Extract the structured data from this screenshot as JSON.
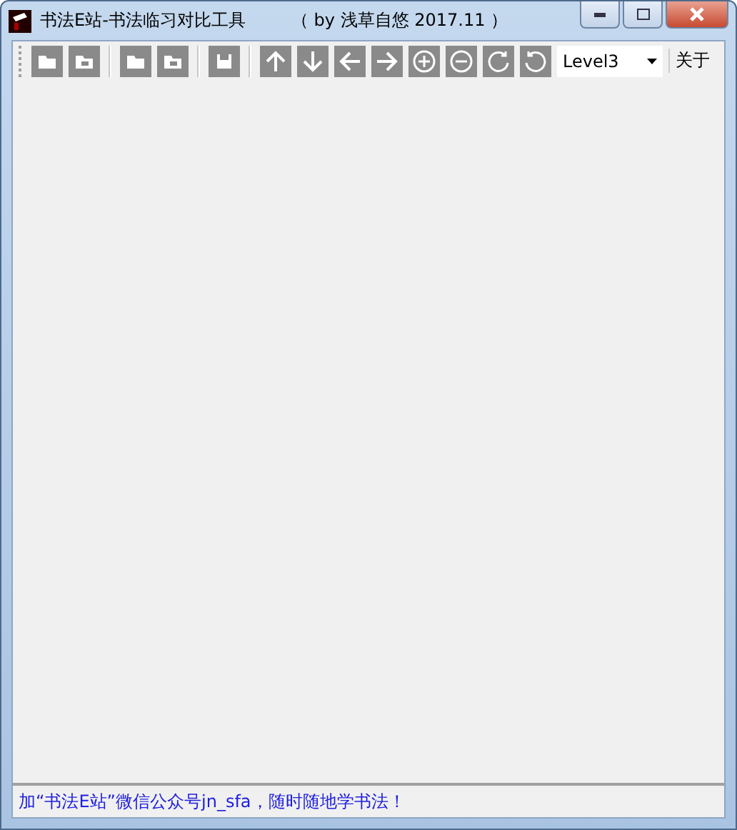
{
  "window": {
    "title": "书法E站-书法临习对比工具",
    "subtitle": "（ by 浅草自悠  2017.11 ）"
  },
  "toolbar": {
    "groups": [
      [
        {
          "kind": "open"
        },
        {
          "kind": "open-image"
        }
      ],
      [
        {
          "kind": "open"
        },
        {
          "kind": "open-image"
        }
      ],
      [
        {
          "kind": "save"
        }
      ],
      [
        {
          "kind": "up"
        },
        {
          "kind": "down"
        },
        {
          "kind": "left"
        },
        {
          "kind": "right"
        },
        {
          "kind": "zoom-in"
        },
        {
          "kind": "zoom-out"
        },
        {
          "kind": "rotate-cw"
        },
        {
          "kind": "rotate-ccw"
        }
      ]
    ],
    "level_select": {
      "value": "Level3"
    },
    "about": "关于"
  },
  "status_bar": "加“书法E站”微信公众号jn_sfa，随时随地学书法！"
}
